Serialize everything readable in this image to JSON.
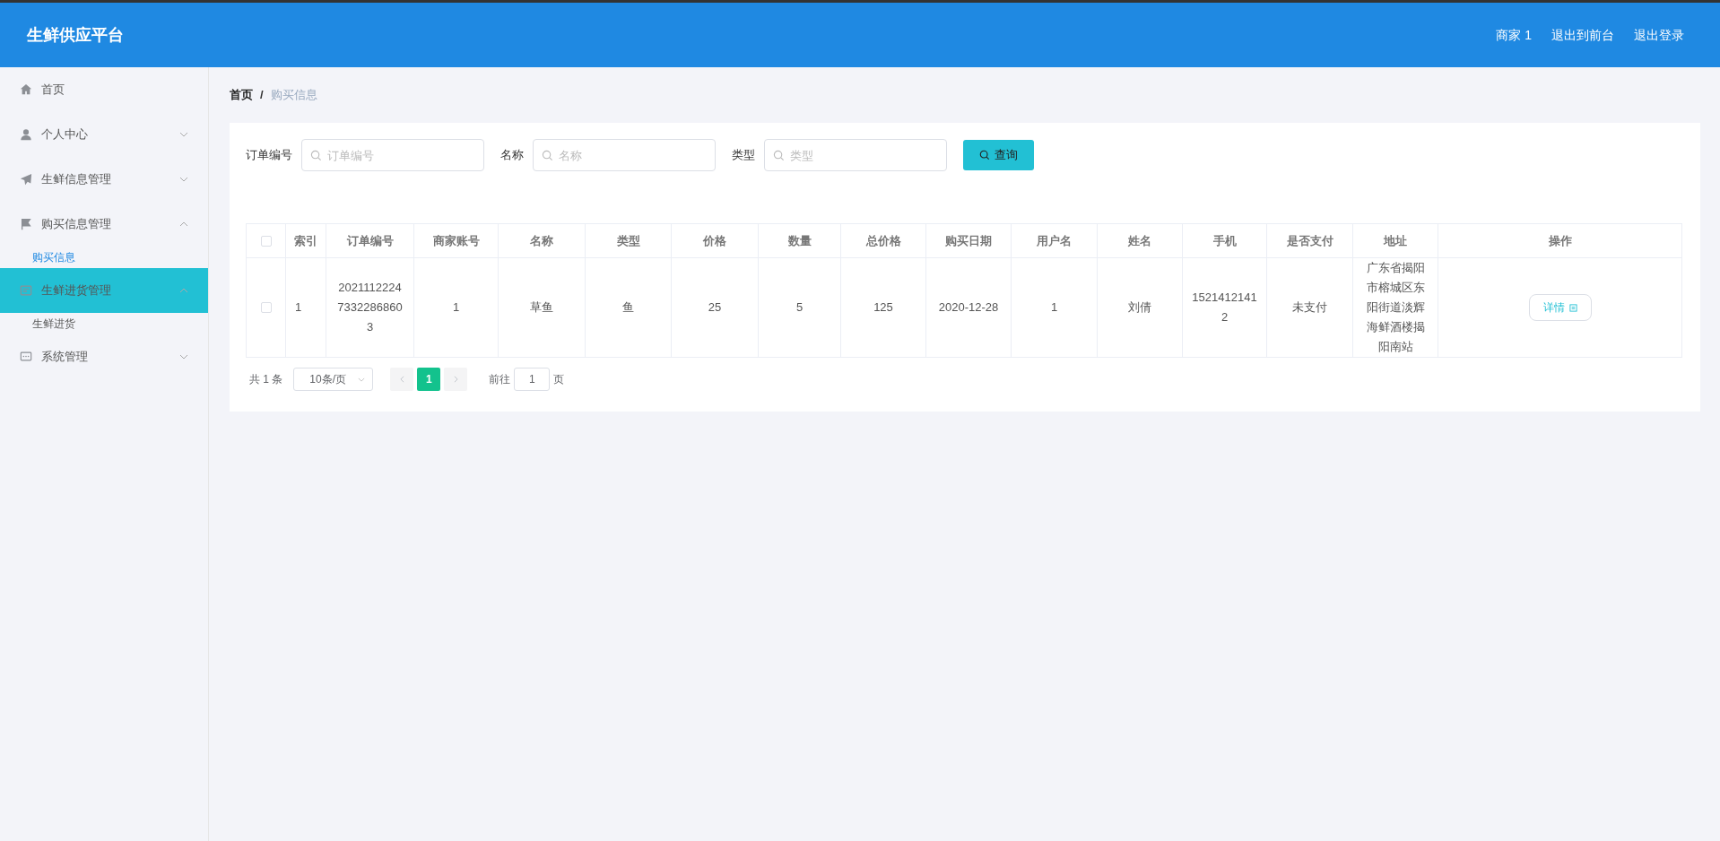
{
  "header": {
    "title": "生鲜供应平台",
    "links": [
      "商家 1",
      "退出到前台",
      "退出登录"
    ]
  },
  "sidebar": {
    "items": [
      {
        "kind": "home",
        "label": "首页",
        "selected": false
      },
      {
        "kind": "user",
        "label": "个人中心",
        "selected": false,
        "expanded": false
      },
      {
        "kind": "send",
        "label": "生鲜信息管理",
        "selected": false,
        "expanded": false
      },
      {
        "kind": "flag",
        "label": "购买信息管理",
        "selected": false,
        "expanded": true,
        "children": [
          {
            "label": "购买信息",
            "selected": true
          }
        ]
      },
      {
        "kind": "doc",
        "label": "生鲜进货管理",
        "selected": true,
        "expanded": true,
        "children": [
          {
            "label": "生鲜进货",
            "selected": false
          }
        ]
      },
      {
        "kind": "chat",
        "label": "系统管理",
        "selected": false,
        "expanded": false
      }
    ]
  },
  "breadcrumb": {
    "separator": "/",
    "items": [
      "首页",
      "购买信息"
    ]
  },
  "search": {
    "fields": [
      {
        "label": "订单编号",
        "placeholder": "订单编号"
      },
      {
        "label": "名称",
        "placeholder": "名称"
      },
      {
        "label": "类型",
        "placeholder": "类型"
      }
    ],
    "button": "查询"
  },
  "table": {
    "select_all_checked": false,
    "columns": [
      "索引",
      "订单编号",
      "商家账号",
      "名称",
      "类型",
      "价格",
      "数量",
      "总价格",
      "购买日期",
      "用户名",
      "姓名",
      "手机",
      "是否支付",
      "地址",
      "操作"
    ],
    "rows": [
      {
        "checked": false,
        "cells": [
          "1",
          "202111222473322868603",
          "1",
          "草鱼",
          "鱼",
          "25",
          "5",
          "125",
          "2020-12-28",
          "1",
          "刘倩",
          "15214121412",
          "未支付",
          "广东省揭阳市榕城区东阳街道淡辉海鲜酒楼揭阳南站"
        ],
        "action": "详情"
      }
    ]
  },
  "pagination": {
    "total": "共 1 条",
    "page_size": "10条/页",
    "pages": [
      {
        "label": "1",
        "selected": true
      }
    ],
    "goto_label": "前往",
    "goto_value": "1",
    "goto_suffix": "页"
  }
}
